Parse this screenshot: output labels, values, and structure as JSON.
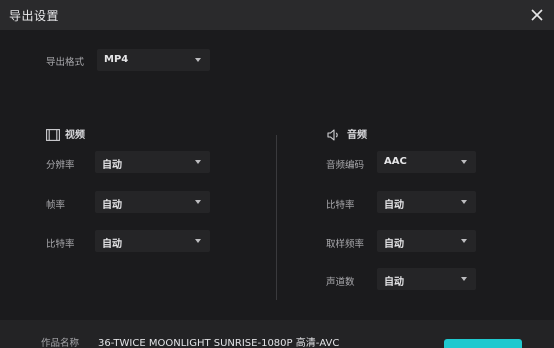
{
  "dialog": {
    "title": "导出设置"
  },
  "format": {
    "label": "导出格式",
    "value": "MP4"
  },
  "video": {
    "heading": "视频",
    "resolution": {
      "label": "分辨率",
      "value": "自动"
    },
    "framerate": {
      "label": "帧率",
      "value": "自动"
    },
    "bitrate": {
      "label": "比特率",
      "value": "自动"
    }
  },
  "audio": {
    "heading": "音频",
    "codec": {
      "label": "音频编码",
      "value": "AAC"
    },
    "bitrate": {
      "label": "比特率",
      "value": "自动"
    },
    "samplerate": {
      "label": "取样频率",
      "value": "自动"
    },
    "channels": {
      "label": "声道数",
      "value": "自动"
    }
  },
  "footer": {
    "name_label": "作品名称",
    "name_value": "36-TWICE MOONLIGHT SUNRISE-1080P 高清-AVC"
  },
  "colors": {
    "accent": "#1fc9cf",
    "background": "#1b1b1d",
    "titlebar": "#2a2a2c"
  },
  "icons": {
    "close": "close-icon",
    "video": "film-icon",
    "audio": "speaker-icon",
    "dropdown": "chevron-down-icon"
  }
}
